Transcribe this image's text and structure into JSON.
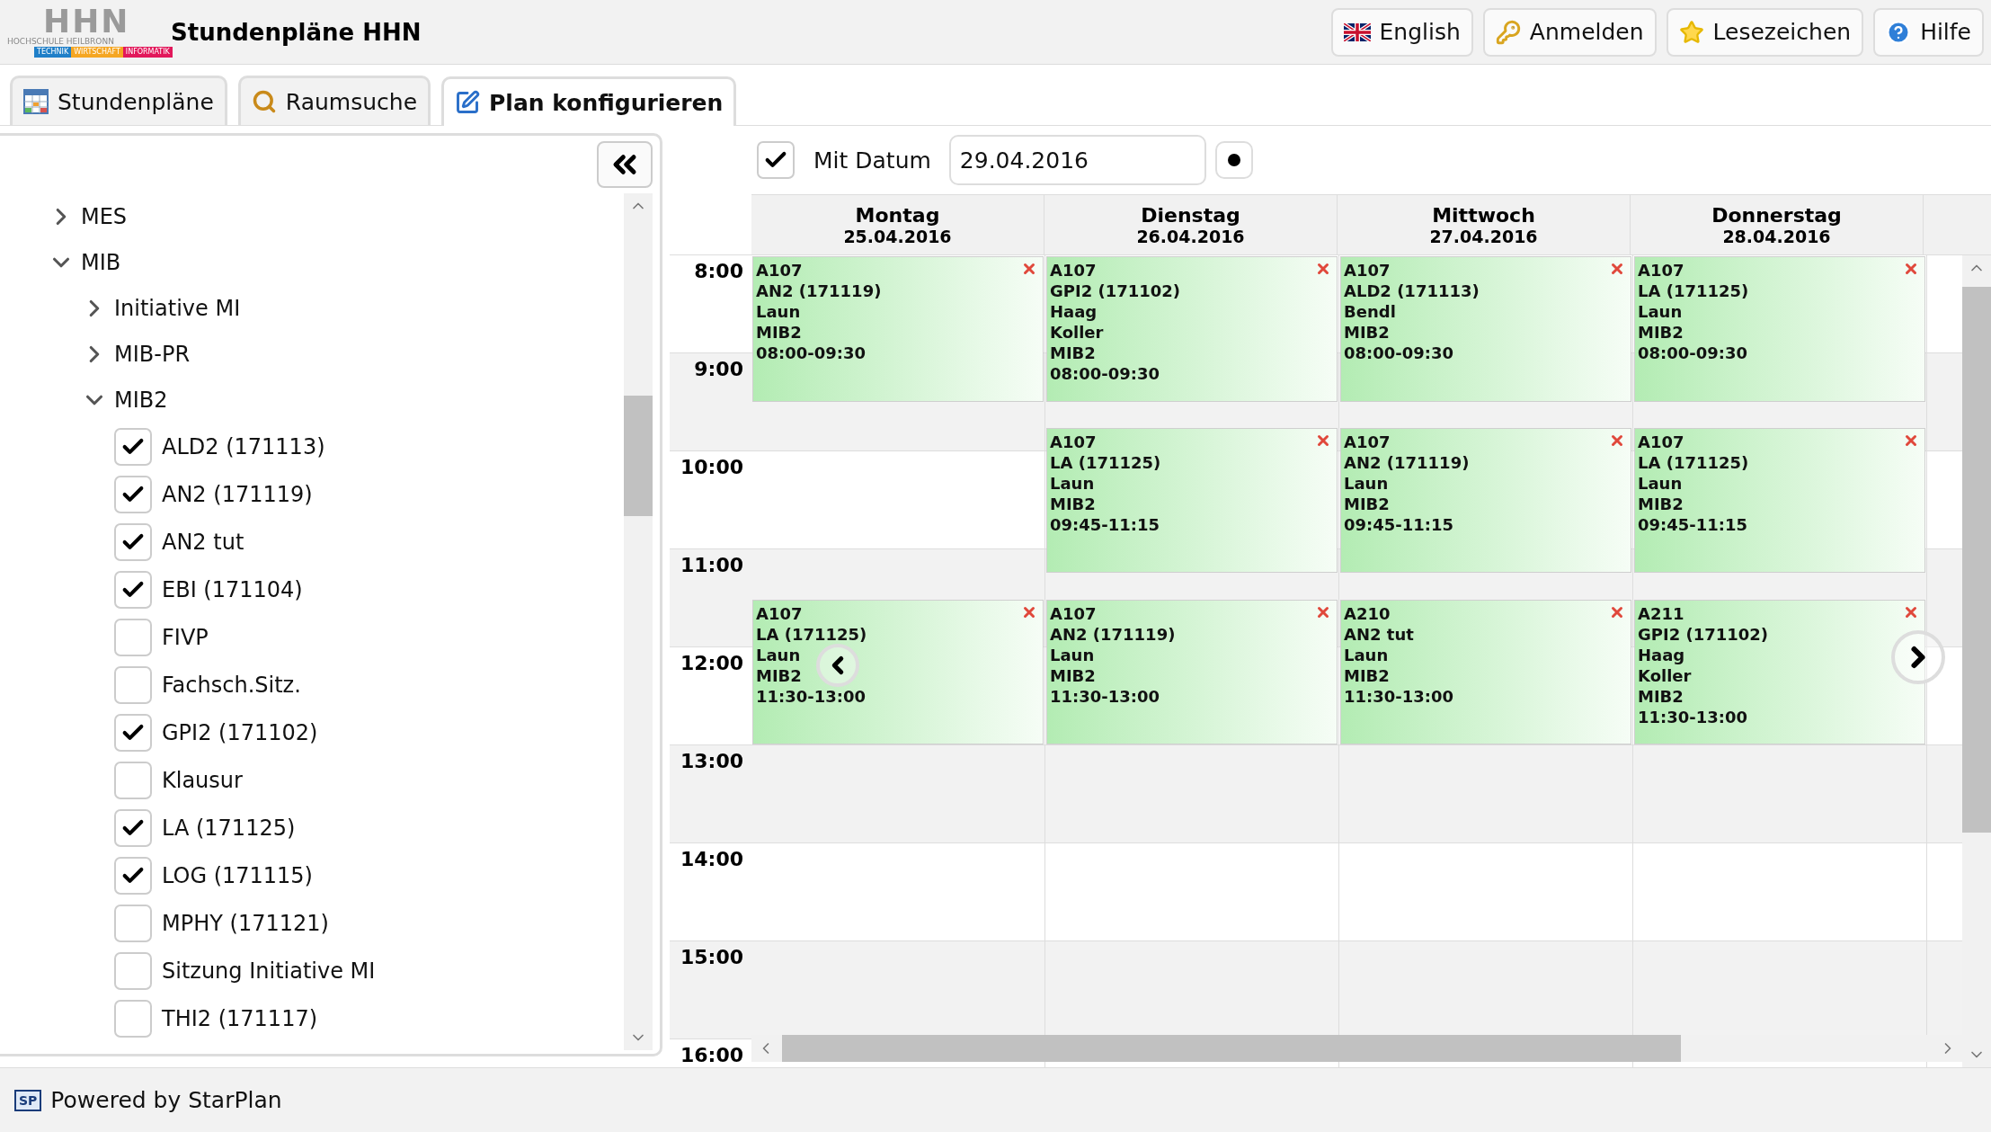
{
  "header": {
    "logo": {
      "letters": "HHN",
      "name": "HOCHSCHULE HEILBRONN",
      "faculties": [
        {
          "label": "TECHNIK",
          "color": "#1f7fc8"
        },
        {
          "label": "WIRTSCHAFT",
          "color": "#f5a623"
        },
        {
          "label": "INFORMATIK",
          "color": "#e2185b"
        }
      ]
    },
    "title": "Stundenpläne HHN",
    "buttons": [
      {
        "kind": "flag",
        "label": "English"
      },
      {
        "kind": "key",
        "label": "Anmelden"
      },
      {
        "kind": "star",
        "label": "Lesezeichen"
      },
      {
        "kind": "help",
        "label": "Hilfe"
      }
    ]
  },
  "tabs": [
    {
      "kind": "timetable",
      "label": "Stundenpläne",
      "selected": false
    },
    {
      "kind": "search",
      "label": "Raumsuche",
      "selected": false
    },
    {
      "kind": "edit",
      "label": "Plan konfigurieren",
      "selected": true
    }
  ],
  "sidebar": {
    "tree": [
      {
        "kind": "group",
        "label": "MES",
        "expanded": false
      },
      {
        "kind": "group",
        "label": "MIB",
        "expanded": true,
        "children": [
          {
            "kind": "group",
            "label": "Initiative MI",
            "expanded": false
          },
          {
            "kind": "group",
            "label": "MIB-PR",
            "expanded": false
          },
          {
            "kind": "group",
            "label": "MIB2",
            "expanded": true,
            "children": [
              {
                "kind": "course",
                "label": "ALD2 (171113)",
                "checked": true
              },
              {
                "kind": "course",
                "label": "AN2 (171119)",
                "checked": true
              },
              {
                "kind": "course",
                "label": "AN2 tut",
                "checked": true
              },
              {
                "kind": "course",
                "label": "EBI (171104)",
                "checked": true
              },
              {
                "kind": "course",
                "label": "FIVP",
                "checked": false
              },
              {
                "kind": "course",
                "label": "Fachsch.Sitz.",
                "checked": false
              },
              {
                "kind": "course",
                "label": "GPI2 (171102)",
                "checked": true
              },
              {
                "kind": "course",
                "label": "Klausur",
                "checked": false
              },
              {
                "kind": "course",
                "label": "LA (171125)",
                "checked": true
              },
              {
                "kind": "course",
                "label": "LOG (171115)",
                "checked": true
              },
              {
                "kind": "course",
                "label": "MPHY (171121)",
                "checked": false
              },
              {
                "kind": "course",
                "label": "Sitzung Initiative MI",
                "checked": false
              },
              {
                "kind": "course",
                "label": "THI2 (171117)",
                "checked": false
              }
            ]
          }
        ]
      }
    ]
  },
  "calendar": {
    "show_date": {
      "label": "Mit Datum",
      "checked": true
    },
    "date": "29.04.2016",
    "times": [
      "8:00",
      "9:00",
      "10:00",
      "11:00",
      "12:00",
      "13:00",
      "14:00",
      "15:00",
      "16:00"
    ],
    "days": [
      {
        "name": "Montag",
        "date": "25.04.2016",
        "events": [
          {
            "room": "A107",
            "course": "AN2 (171119)",
            "lecturers": [
              "Laun"
            ],
            "group": "MIB2",
            "time": "08:00-09:30"
          },
          {
            "room": "A107",
            "course": "LA (171125)",
            "lecturers": [
              "Laun"
            ],
            "group": "MIB2",
            "time": "11:30-13:00"
          }
        ]
      },
      {
        "name": "Dienstag",
        "date": "26.04.2016",
        "events": [
          {
            "room": "A107",
            "course": "GPI2 (171102)",
            "lecturers": [
              "Haag",
              "Koller"
            ],
            "group": "MIB2",
            "time": "08:00-09:30"
          },
          {
            "room": "A107",
            "course": "LA (171125)",
            "lecturers": [
              "Laun"
            ],
            "group": "MIB2",
            "time": "09:45-11:15"
          },
          {
            "room": "A107",
            "course": "AN2 (171119)",
            "lecturers": [
              "Laun"
            ],
            "group": "MIB2",
            "time": "11:30-13:00"
          }
        ]
      },
      {
        "name": "Mittwoch",
        "date": "27.04.2016",
        "events": [
          {
            "room": "A107",
            "course": "ALD2 (171113)",
            "lecturers": [
              "Bendl"
            ],
            "group": "MIB2",
            "time": "08:00-09:30"
          },
          {
            "room": "A107",
            "course": "AN2 (171119)",
            "lecturers": [
              "Laun"
            ],
            "group": "MIB2",
            "time": "09:45-11:15"
          },
          {
            "room": "A210",
            "course": "AN2 tut",
            "lecturers": [
              "Laun"
            ],
            "group": "MIB2",
            "time": "11:30-13:00"
          }
        ]
      },
      {
        "name": "Donnerstag",
        "date": "28.04.2016",
        "events": [
          {
            "room": "A107",
            "course": "LA (171125)",
            "lecturers": [
              "Laun"
            ],
            "group": "MIB2",
            "time": "08:00-09:30"
          },
          {
            "room": "A107",
            "course": "LA (171125)",
            "lecturers": [
              "Laun"
            ],
            "group": "MIB2",
            "time": "09:45-11:15"
          },
          {
            "room": "A211",
            "course": "GPI2 (171102)",
            "lecturers": [
              "Haag",
              "Koller"
            ],
            "group": "MIB2",
            "time": "11:30-13:00"
          }
        ]
      }
    ]
  },
  "footer": {
    "logo": "SP",
    "text": "Powered by StarPlan"
  }
}
